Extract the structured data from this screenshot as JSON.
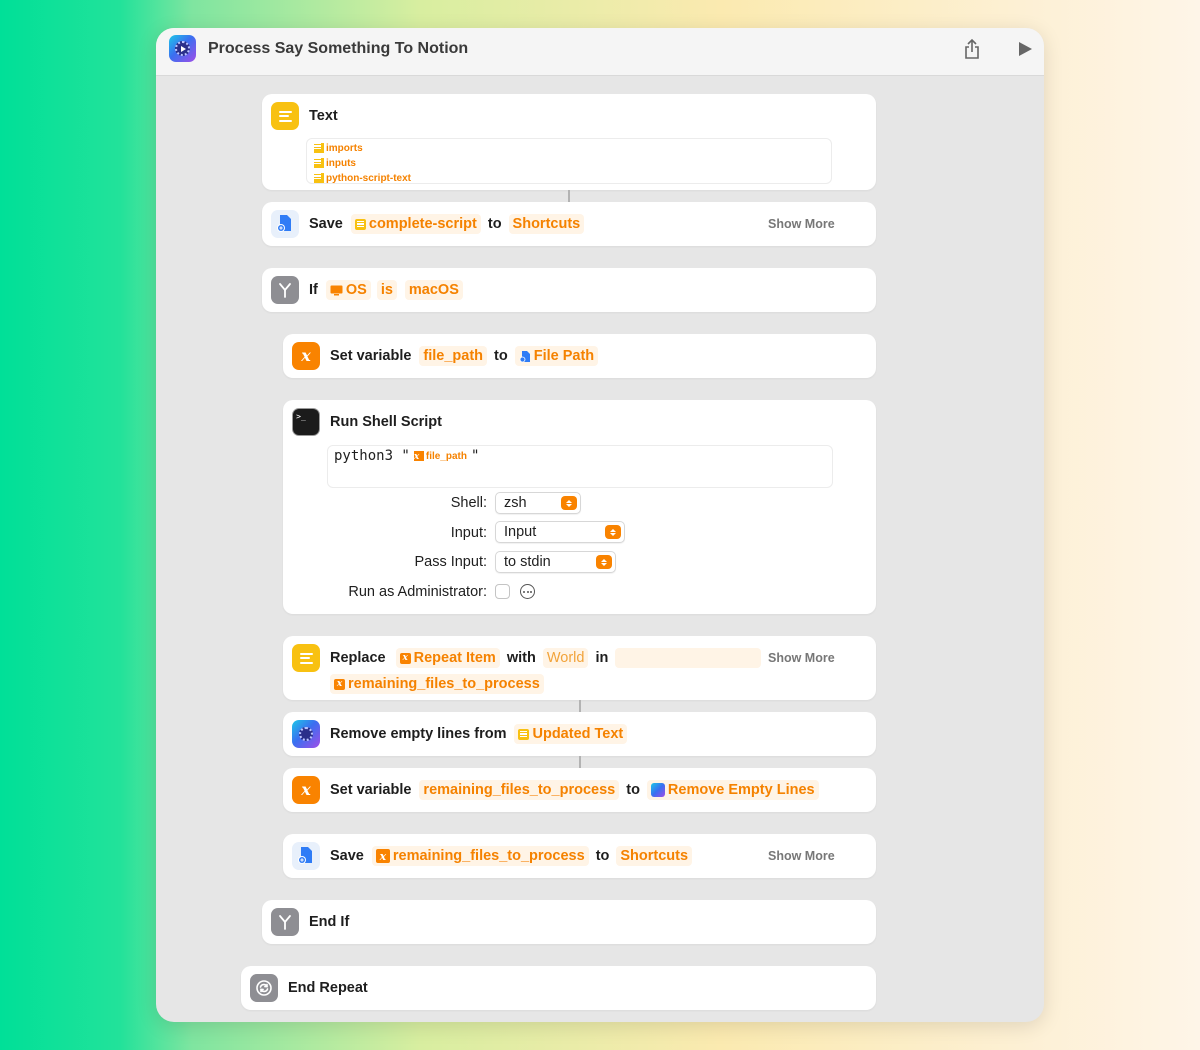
{
  "window": {
    "title": "Process Say Something To Notion"
  },
  "text_action": {
    "label": "Text",
    "tokens": [
      "imports",
      "inputs",
      "python-script-text"
    ]
  },
  "save_action_1": {
    "label": "Save",
    "variable": "complete-script",
    "to": "to",
    "destination": "Shortcuts",
    "show_more": "Show More"
  },
  "if_action": {
    "label": "If",
    "input": "OS",
    "condition": "is",
    "value": "macOS"
  },
  "set_var_1": {
    "label": "Set variable",
    "name": "file_path",
    "to": "to",
    "value": "File Path"
  },
  "shell_action": {
    "label": "Run Shell Script",
    "script_prefix": "python3 \"",
    "script_var": "file_path",
    "script_suffix": "\"",
    "shell_label": "Shell:",
    "shell_value": "zsh",
    "input_label": "Input:",
    "input_value": "Input",
    "pass_input_label": "Pass Input:",
    "pass_input_value": "to stdin",
    "admin_label": "Run as Administrator:"
  },
  "replace_action": {
    "label": "Replace",
    "find": "Repeat Item",
    "with": "with",
    "replacement": "World",
    "in": "in",
    "source": "remaining_files_to_process",
    "show_more": "Show More"
  },
  "remove_empty": {
    "label": "Remove empty lines from",
    "input": "Updated Text"
  },
  "set_var_2": {
    "label": "Set variable",
    "name": "remaining_files_to_process",
    "to": "to",
    "value": "Remove Empty Lines"
  },
  "save_action_2": {
    "label": "Save",
    "variable": "remaining_files_to_process",
    "to": "to",
    "destination": "Shortcuts",
    "show_more": "Show More"
  },
  "end_if": {
    "label": "End If"
  },
  "end_repeat": {
    "label": "End Repeat"
  },
  "colors": {
    "accent": "#f98300",
    "token_text": "#f58200",
    "token_bg": "#fff4e6",
    "text_icon": "#f8c111",
    "control_icon": "#8e8e93"
  }
}
